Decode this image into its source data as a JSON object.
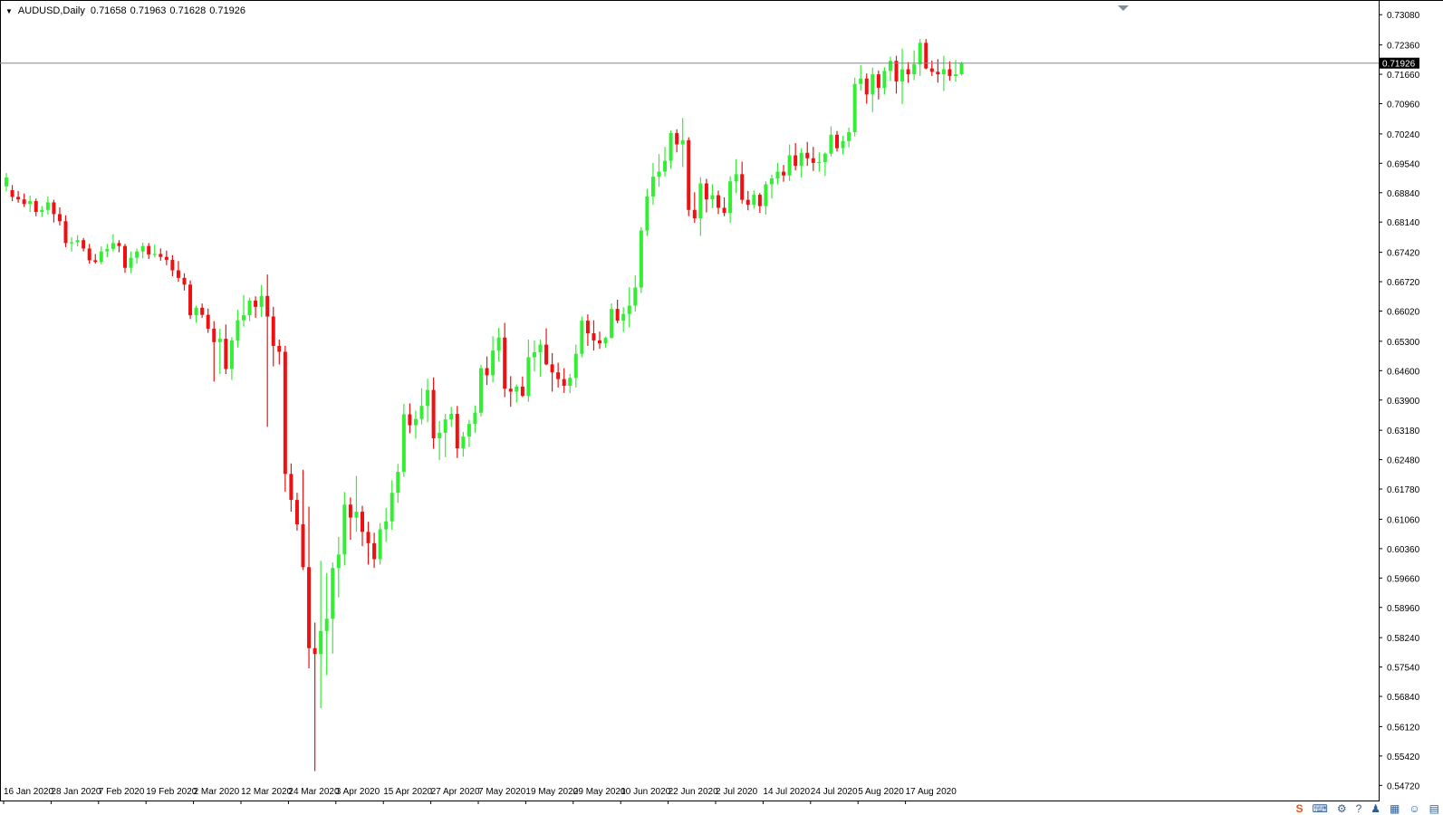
{
  "window": {
    "symbol": "AUDUSD,Daily",
    "ohlc": {
      "open": "0.71658",
      "high": "0.71963",
      "low": "0.71628",
      "close": "0.71926"
    }
  },
  "colors": {
    "bull": "#33ee33",
    "bear": "#ee1111",
    "background": "#ffffff",
    "axis": "#000000",
    "price_line": "#7a8a99",
    "price_tag_bg": "#000000",
    "price_tag_text": "#ffffff",
    "shift_marker": "#7f8c99"
  },
  "tray_icons": [
    "brand-icon",
    "keyboard-icon",
    "settings-icon",
    "help-icon",
    "shirt-icon",
    "grid-icon",
    "user-icon",
    "apps-icon"
  ],
  "chart_data": {
    "type": "candlestick",
    "title": "AUDUSD,Daily",
    "ylim": [
      0.5436,
      0.7343
    ],
    "y_ticks": [
      "0.73080",
      "0.72360",
      "0.71660",
      "0.70960",
      "0.70240",
      "0.69540",
      "0.68840",
      "0.68140",
      "0.67420",
      "0.66720",
      "0.66020",
      "0.65300",
      "0.64600",
      "0.63900",
      "0.63180",
      "0.62480",
      "0.61780",
      "0.61060",
      "0.60360",
      "0.59660",
      "0.58960",
      "0.58240",
      "0.57540",
      "0.56840",
      "0.56120",
      "0.55420",
      "0.54720"
    ],
    "x_ticks": [
      "16 Jan 2020",
      "28 Jan 2020",
      "7 Feb 2020",
      "19 Feb 2020",
      "2 Mar 2020",
      "12 Mar 2020",
      "24 Mar 2020",
      "3 Apr 2020",
      "15 Apr 2020",
      "27 Apr 2020",
      "7 May 2020",
      "19 May 2020",
      "29 May 2020",
      "10 Jun 2020",
      "22 Jun 2020",
      "2 Jul 2020",
      "14 Jul 2020",
      "24 Jul 2020",
      "5 Aug 2020",
      "17 Aug 2020"
    ],
    "x_tick_bar_index": [
      0,
      8,
      16,
      24,
      32,
      40,
      48,
      56,
      64,
      72,
      80,
      88,
      96,
      104,
      112,
      120,
      128,
      136,
      144,
      152
    ],
    "current_price": "0.71926",
    "current_price_value": 0.71926,
    "grid": false,
    "candles": [
      [
        0.6899,
        0.6931,
        0.6887,
        0.692
      ],
      [
        0.689,
        0.6902,
        0.6864,
        0.6874
      ],
      [
        0.6874,
        0.6888,
        0.686,
        0.6868
      ],
      [
        0.6868,
        0.6882,
        0.685,
        0.6857
      ],
      [
        0.6857,
        0.6877,
        0.6838,
        0.6864
      ],
      [
        0.6864,
        0.687,
        0.6828,
        0.6838
      ],
      [
        0.6838,
        0.6852,
        0.6826,
        0.6843
      ],
      [
        0.6843,
        0.6875,
        0.6832,
        0.6861
      ],
      [
        0.6861,
        0.6867,
        0.6813,
        0.6833
      ],
      [
        0.6833,
        0.6849,
        0.6806,
        0.6816
      ],
      [
        0.6816,
        0.683,
        0.6754,
        0.6764
      ],
      [
        0.6764,
        0.6778,
        0.6744,
        0.6766
      ],
      [
        0.6766,
        0.6783,
        0.6756,
        0.6771
      ],
      [
        0.6771,
        0.6776,
        0.6744,
        0.6751
      ],
      [
        0.6751,
        0.6762,
        0.6715,
        0.6723
      ],
      [
        0.6723,
        0.6738,
        0.6715,
        0.6719
      ],
      [
        0.6719,
        0.6756,
        0.6713,
        0.6744
      ],
      [
        0.6744,
        0.6762,
        0.673,
        0.675
      ],
      [
        0.675,
        0.6785,
        0.6744,
        0.6764
      ],
      [
        0.6764,
        0.6771,
        0.6742,
        0.6757
      ],
      [
        0.6757,
        0.6762,
        0.6693,
        0.6705
      ],
      [
        0.6705,
        0.6744,
        0.6692,
        0.6729
      ],
      [
        0.6729,
        0.6751,
        0.6715,
        0.6744
      ],
      [
        0.6744,
        0.6765,
        0.6728,
        0.6757
      ],
      [
        0.6757,
        0.6764,
        0.6726,
        0.6737
      ],
      [
        0.6737,
        0.676,
        0.673,
        0.6738
      ],
      [
        0.6738,
        0.6751,
        0.6722,
        0.6731
      ],
      [
        0.6731,
        0.6746,
        0.6711,
        0.6724
      ],
      [
        0.6724,
        0.6735,
        0.6685,
        0.6699
      ],
      [
        0.6699,
        0.6721,
        0.6672,
        0.6681
      ],
      [
        0.6681,
        0.6692,
        0.6651,
        0.6665
      ],
      [
        0.6665,
        0.6675,
        0.6583,
        0.6592
      ],
      [
        0.6592,
        0.6615,
        0.6574,
        0.661
      ],
      [
        0.661,
        0.662,
        0.6586,
        0.6593
      ],
      [
        0.6593,
        0.6608,
        0.655,
        0.656
      ],
      [
        0.656,
        0.6578,
        0.6434,
        0.6528
      ],
      [
        0.6528,
        0.656,
        0.6452,
        0.6536
      ],
      [
        0.6536,
        0.657,
        0.6452,
        0.6464
      ],
      [
        0.6464,
        0.654,
        0.6438,
        0.6532
      ],
      [
        0.6532,
        0.6605,
        0.6515,
        0.658
      ],
      [
        0.658,
        0.664,
        0.6565,
        0.6592
      ],
      [
        0.6592,
        0.6634,
        0.6578,
        0.6627
      ],
      [
        0.6627,
        0.6637,
        0.6586,
        0.6612
      ],
      [
        0.6612,
        0.6664,
        0.6588,
        0.6638
      ],
      [
        0.6638,
        0.6689,
        0.6326,
        0.6589
      ],
      [
        0.6589,
        0.6612,
        0.647,
        0.6519
      ],
      [
        0.6519,
        0.6534,
        0.6475,
        0.6505
      ],
      [
        0.6505,
        0.6519,
        0.6172,
        0.6214
      ],
      [
        0.6214,
        0.6239,
        0.6124,
        0.6152
      ],
      [
        0.6152,
        0.6169,
        0.6079,
        0.6094
      ],
      [
        0.6094,
        0.6224,
        0.5985,
        0.5992
      ],
      [
        0.5992,
        0.6136,
        0.5751,
        0.5799
      ],
      [
        0.5799,
        0.586,
        0.5506,
        0.5785
      ],
      [
        0.5785,
        0.6007,
        0.5656,
        0.584
      ],
      [
        0.584,
        0.5978,
        0.5735,
        0.5869
      ],
      [
        0.5869,
        0.6003,
        0.5786,
        0.599
      ],
      [
        0.599,
        0.6064,
        0.592,
        0.6022
      ],
      [
        0.6022,
        0.6171,
        0.5996,
        0.6141
      ],
      [
        0.6141,
        0.6158,
        0.6057,
        0.611
      ],
      [
        0.611,
        0.6209,
        0.6076,
        0.6124
      ],
      [
        0.6124,
        0.6138,
        0.6042,
        0.6076
      ],
      [
        0.6076,
        0.61,
        0.5998,
        0.6049
      ],
      [
        0.6049,
        0.6074,
        0.599,
        0.6011
      ],
      [
        0.6011,
        0.6097,
        0.5998,
        0.6082
      ],
      [
        0.6082,
        0.6133,
        0.6052,
        0.6101
      ],
      [
        0.6101,
        0.6199,
        0.6081,
        0.6169
      ],
      [
        0.6169,
        0.6238,
        0.6145,
        0.6219
      ],
      [
        0.6219,
        0.6381,
        0.6207,
        0.6356
      ],
      [
        0.6356,
        0.6382,
        0.6311,
        0.633
      ],
      [
        0.633,
        0.6365,
        0.6298,
        0.6345
      ],
      [
        0.6345,
        0.6418,
        0.6332,
        0.6376
      ],
      [
        0.6376,
        0.6441,
        0.6337,
        0.6414
      ],
      [
        0.6414,
        0.6444,
        0.6274,
        0.6299
      ],
      [
        0.6299,
        0.634,
        0.6247,
        0.6312
      ],
      [
        0.6312,
        0.6357,
        0.6254,
        0.6344
      ],
      [
        0.6344,
        0.6374,
        0.6326,
        0.6357
      ],
      [
        0.6357,
        0.6376,
        0.6252,
        0.6275
      ],
      [
        0.6275,
        0.6314,
        0.6255,
        0.6303
      ],
      [
        0.6303,
        0.6343,
        0.6278,
        0.6333
      ],
      [
        0.6333,
        0.6377,
        0.6312,
        0.636
      ],
      [
        0.636,
        0.6474,
        0.6351,
        0.6466
      ],
      [
        0.6466,
        0.6494,
        0.6426,
        0.6449
      ],
      [
        0.6449,
        0.6542,
        0.6432,
        0.6508
      ],
      [
        0.6508,
        0.6562,
        0.6482,
        0.6539
      ],
      [
        0.6539,
        0.6574,
        0.6397,
        0.6417
      ],
      [
        0.6417,
        0.6447,
        0.6374,
        0.641
      ],
      [
        0.641,
        0.6427,
        0.6384,
        0.6422
      ],
      [
        0.6422,
        0.6446,
        0.6397,
        0.64
      ],
      [
        0.64,
        0.6534,
        0.6386,
        0.6492
      ],
      [
        0.6492,
        0.6532,
        0.6458,
        0.6504
      ],
      [
        0.6504,
        0.6534,
        0.6445,
        0.6522
      ],
      [
        0.6522,
        0.6561,
        0.6473,
        0.6475
      ],
      [
        0.6475,
        0.6502,
        0.641,
        0.6456
      ],
      [
        0.6456,
        0.6479,
        0.642,
        0.644
      ],
      [
        0.644,
        0.6466,
        0.6407,
        0.6424
      ],
      [
        0.6424,
        0.6452,
        0.6406,
        0.6443
      ],
      [
        0.6443,
        0.6522,
        0.642,
        0.65
      ],
      [
        0.65,
        0.6589,
        0.6492,
        0.6579
      ],
      [
        0.6579,
        0.6594,
        0.6519,
        0.6549
      ],
      [
        0.6549,
        0.658,
        0.6508,
        0.6532
      ],
      [
        0.6532,
        0.6553,
        0.6512,
        0.6525
      ],
      [
        0.6525,
        0.6541,
        0.6514,
        0.6538
      ],
      [
        0.6538,
        0.662,
        0.6537,
        0.6607
      ],
      [
        0.6607,
        0.6629,
        0.6573,
        0.6579
      ],
      [
        0.6579,
        0.6611,
        0.6552,
        0.6595
      ],
      [
        0.6595,
        0.6659,
        0.6563,
        0.6615
      ],
      [
        0.6615,
        0.6687,
        0.6601,
        0.6658
      ],
      [
        0.6658,
        0.6802,
        0.6645,
        0.6794
      ],
      [
        0.6794,
        0.6893,
        0.6781,
        0.6875
      ],
      [
        0.6875,
        0.6955,
        0.6855,
        0.6922
      ],
      [
        0.6922,
        0.6976,
        0.6898,
        0.6934
      ],
      [
        0.6934,
        0.6993,
        0.6922,
        0.696
      ],
      [
        0.696,
        0.7032,
        0.6941,
        0.7026
      ],
      [
        0.7026,
        0.7035,
        0.698,
        0.6999
      ],
      [
        0.6999,
        0.7062,
        0.6945,
        0.7009
      ],
      [
        0.7009,
        0.7016,
        0.6828,
        0.6843
      ],
      [
        0.6843,
        0.6885,
        0.6812,
        0.6823
      ],
      [
        0.6823,
        0.6921,
        0.6781,
        0.6906
      ],
      [
        0.6906,
        0.6917,
        0.6837,
        0.6868
      ],
      [
        0.6868,
        0.6904,
        0.6847,
        0.6878
      ],
      [
        0.6878,
        0.6889,
        0.6833,
        0.6848
      ],
      [
        0.6848,
        0.6873,
        0.6828,
        0.6836
      ],
      [
        0.6836,
        0.6923,
        0.6812,
        0.6911
      ],
      [
        0.6911,
        0.6964,
        0.6883,
        0.6928
      ],
      [
        0.6928,
        0.6958,
        0.6858,
        0.6867
      ],
      [
        0.6867,
        0.6888,
        0.6842,
        0.6855
      ],
      [
        0.6855,
        0.6889,
        0.6846,
        0.6879
      ],
      [
        0.6879,
        0.6883,
        0.6836,
        0.6852
      ],
      [
        0.6852,
        0.6911,
        0.6832,
        0.6904
      ],
      [
        0.6904,
        0.6927,
        0.687,
        0.6918
      ],
      [
        0.6918,
        0.6955,
        0.6904,
        0.6934
      ],
      [
        0.6934,
        0.695,
        0.691,
        0.6925
      ],
      [
        0.6925,
        0.6999,
        0.6912,
        0.6973
      ],
      [
        0.6973,
        0.7002,
        0.6937,
        0.6948
      ],
      [
        0.6948,
        0.699,
        0.692,
        0.6979
      ],
      [
        0.6979,
        0.7005,
        0.6948,
        0.6966
      ],
      [
        0.6966,
        0.6993,
        0.6936,
        0.6955
      ],
      [
        0.6955,
        0.698,
        0.6934,
        0.6957
      ],
      [
        0.6957,
        0.698,
        0.6924,
        0.6977
      ],
      [
        0.6977,
        0.7042,
        0.697,
        0.7022
      ],
      [
        0.7022,
        0.7031,
        0.6982,
        0.699
      ],
      [
        0.699,
        0.7019,
        0.6975,
        0.7007
      ],
      [
        0.7007,
        0.7039,
        0.6992,
        0.7028
      ],
      [
        0.7028,
        0.7158,
        0.7018,
        0.7143
      ],
      [
        0.7143,
        0.7188,
        0.7127,
        0.7156
      ],
      [
        0.7156,
        0.7168,
        0.7096,
        0.7118
      ],
      [
        0.7118,
        0.7182,
        0.7076,
        0.7166
      ],
      [
        0.7166,
        0.7175,
        0.7106,
        0.7134
      ],
      [
        0.7134,
        0.7183,
        0.7118,
        0.7174
      ],
      [
        0.7174,
        0.7208,
        0.715,
        0.7198
      ],
      [
        0.7198,
        0.721,
        0.712,
        0.7149
      ],
      [
        0.7149,
        0.7227,
        0.7095,
        0.7178
      ],
      [
        0.7178,
        0.7195,
        0.7146,
        0.7166
      ],
      [
        0.7166,
        0.7223,
        0.7152,
        0.719
      ],
      [
        0.719,
        0.725,
        0.7162,
        0.7241
      ],
      [
        0.7241,
        0.725,
        0.7178,
        0.718
      ],
      [
        0.718,
        0.7199,
        0.7162,
        0.7172
      ],
      [
        0.7172,
        0.7202,
        0.7146,
        0.7166
      ],
      [
        0.7166,
        0.721,
        0.7126,
        0.7178
      ],
      [
        0.7178,
        0.7197,
        0.7151,
        0.7162
      ],
      [
        0.7162,
        0.72,
        0.7148,
        0.7166
      ],
      [
        0.7166,
        0.7196,
        0.7163,
        0.7193
      ]
    ]
  }
}
